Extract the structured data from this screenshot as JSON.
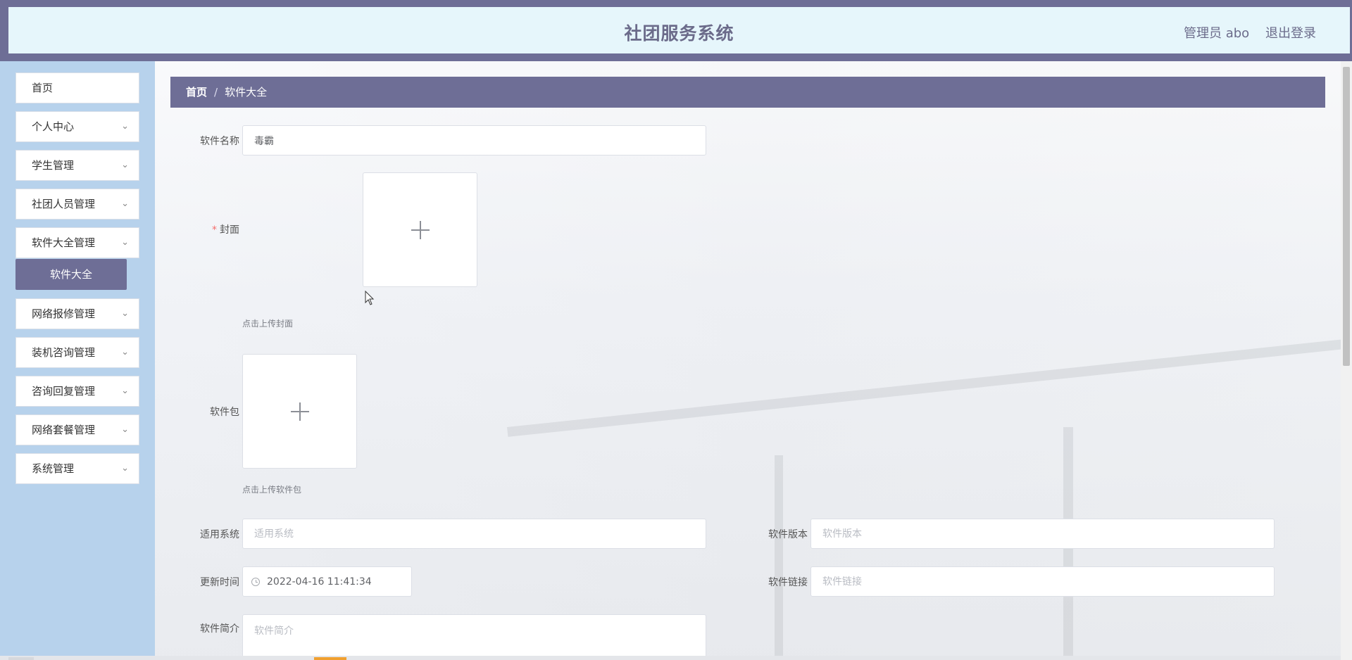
{
  "header": {
    "title": "社团服务系统",
    "user": "管理员 abo",
    "logout": "退出登录"
  },
  "sidebar": {
    "items": [
      {
        "label": "首页",
        "expandable": false
      },
      {
        "label": "个人中心",
        "expandable": true
      },
      {
        "label": "学生管理",
        "expandable": true
      },
      {
        "label": "社团人员管理",
        "expandable": true
      },
      {
        "label": "软件大全管理",
        "expandable": true
      },
      {
        "label": "网络报修管理",
        "expandable": true
      },
      {
        "label": "装机咨询管理",
        "expandable": true
      },
      {
        "label": "咨询回复管理",
        "expandable": true
      },
      {
        "label": "网络套餐管理",
        "expandable": true
      },
      {
        "label": "系统管理",
        "expandable": true
      }
    ],
    "active_sub": "软件大全"
  },
  "breadcrumb": {
    "home": "首页",
    "separator": "/",
    "current": "软件大全"
  },
  "form": {
    "name": {
      "label": "软件名称",
      "value": "毒霸"
    },
    "cover": {
      "required_mark": "*",
      "label": "封面",
      "hint": "点击上传封面"
    },
    "package": {
      "label": "软件包",
      "hint": "点击上传软件包"
    },
    "system": {
      "label": "适用系统",
      "placeholder": "适用系统"
    },
    "version": {
      "label": "软件版本",
      "placeholder": "软件版本"
    },
    "update_time": {
      "label": "更新时间",
      "value": "2022-04-16 11:41:34"
    },
    "link": {
      "label": "软件链接",
      "placeholder": "软件链接"
    },
    "intro": {
      "label": "软件简介",
      "placeholder": "软件简介"
    }
  },
  "icons": {
    "chevron": "chevron-down-icon",
    "upload": "plus-icon",
    "clock": "clock-icon"
  },
  "colors": {
    "accent": "#6e6e96",
    "header_bg": "#e6f6fb",
    "sidebar_bg": "#b7d2ec",
    "required": "#f56c6c"
  }
}
